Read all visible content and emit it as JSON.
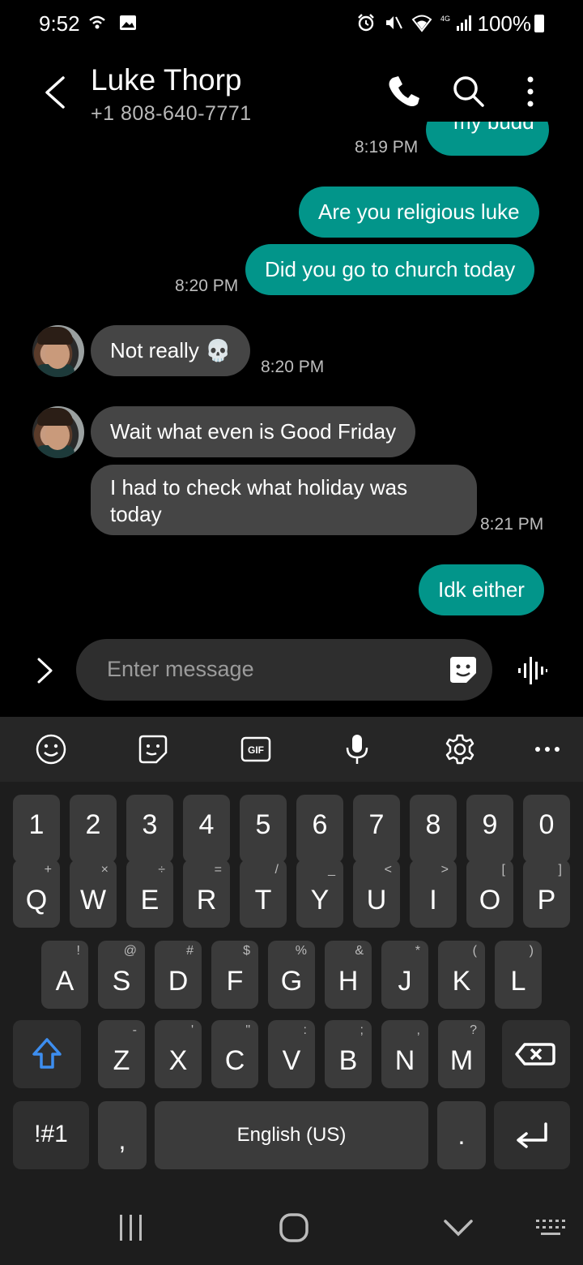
{
  "status_bar": {
    "time": "9:52",
    "battery": "100%",
    "network": "4G"
  },
  "header": {
    "contact_name": "Luke Thorp",
    "contact_phone": "+1 808-640-7771"
  },
  "conversation": {
    "partial_top_message": "my budd",
    "messages": [
      {
        "direction": "outgoing",
        "text": "Are you religious luke"
      },
      {
        "direction": "outgoing",
        "text": "Did you go to church today"
      },
      {
        "direction": "incoming",
        "text": "Not really 💀"
      },
      {
        "direction": "incoming",
        "text": "Wait what even is Good Friday"
      },
      {
        "direction": "incoming",
        "text_line1": "I had to check what holiday was",
        "text_line2": "today"
      },
      {
        "direction": "outgoing",
        "text": "Idk either"
      }
    ],
    "timestamps": [
      "8:19 PM",
      "8:20 PM",
      "8:20 PM",
      "8:21 PM"
    ]
  },
  "composer": {
    "placeholder": "Enter message"
  },
  "keyboard": {
    "number_row": [
      "1",
      "2",
      "3",
      "4",
      "5",
      "6",
      "7",
      "8",
      "9",
      "0"
    ],
    "row1": [
      {
        "main": "Q",
        "sub": "+"
      },
      {
        "main": "W",
        "sub": "×"
      },
      {
        "main": "E",
        "sub": "÷"
      },
      {
        "main": "R",
        "sub": "="
      },
      {
        "main": "T",
        "sub": "/"
      },
      {
        "main": "Y",
        "sub": "_"
      },
      {
        "main": "U",
        "sub": "<"
      },
      {
        "main": "I",
        "sub": ">"
      },
      {
        "main": "O",
        "sub": "["
      },
      {
        "main": "P",
        "sub": "]"
      }
    ],
    "row2": [
      {
        "main": "A",
        "sub": "!"
      },
      {
        "main": "S",
        "sub": "@"
      },
      {
        "main": "D",
        "sub": "#"
      },
      {
        "main": "F",
        "sub": "$"
      },
      {
        "main": "G",
        "sub": "%"
      },
      {
        "main": "H",
        "sub": "&"
      },
      {
        "main": "J",
        "sub": "*"
      },
      {
        "main": "K",
        "sub": "("
      },
      {
        "main": "L",
        "sub": ")"
      }
    ],
    "row3": [
      {
        "main": "Z",
        "sub": "-"
      },
      {
        "main": "X",
        "sub": "'"
      },
      {
        "main": "C",
        "sub": "\""
      },
      {
        "main": "V",
        "sub": ":"
      },
      {
        "main": "B",
        "sub": ";"
      },
      {
        "main": "N",
        "sub": ","
      },
      {
        "main": "M",
        "sub": "?"
      }
    ],
    "symbols_label": "!#1",
    "comma_label": ",",
    "space_label": "English (US)",
    "period_label": ".",
    "toolbar_icons": [
      "emoji-icon",
      "sticker-icon",
      "gif-icon",
      "mic-icon",
      "settings-icon",
      "more-icon"
    ],
    "gif_label": "GIF"
  },
  "colors": {
    "outgoing_bubble": "#02958a",
    "incoming_bubble": "#454545",
    "shift_accent": "#3d8ef0"
  }
}
